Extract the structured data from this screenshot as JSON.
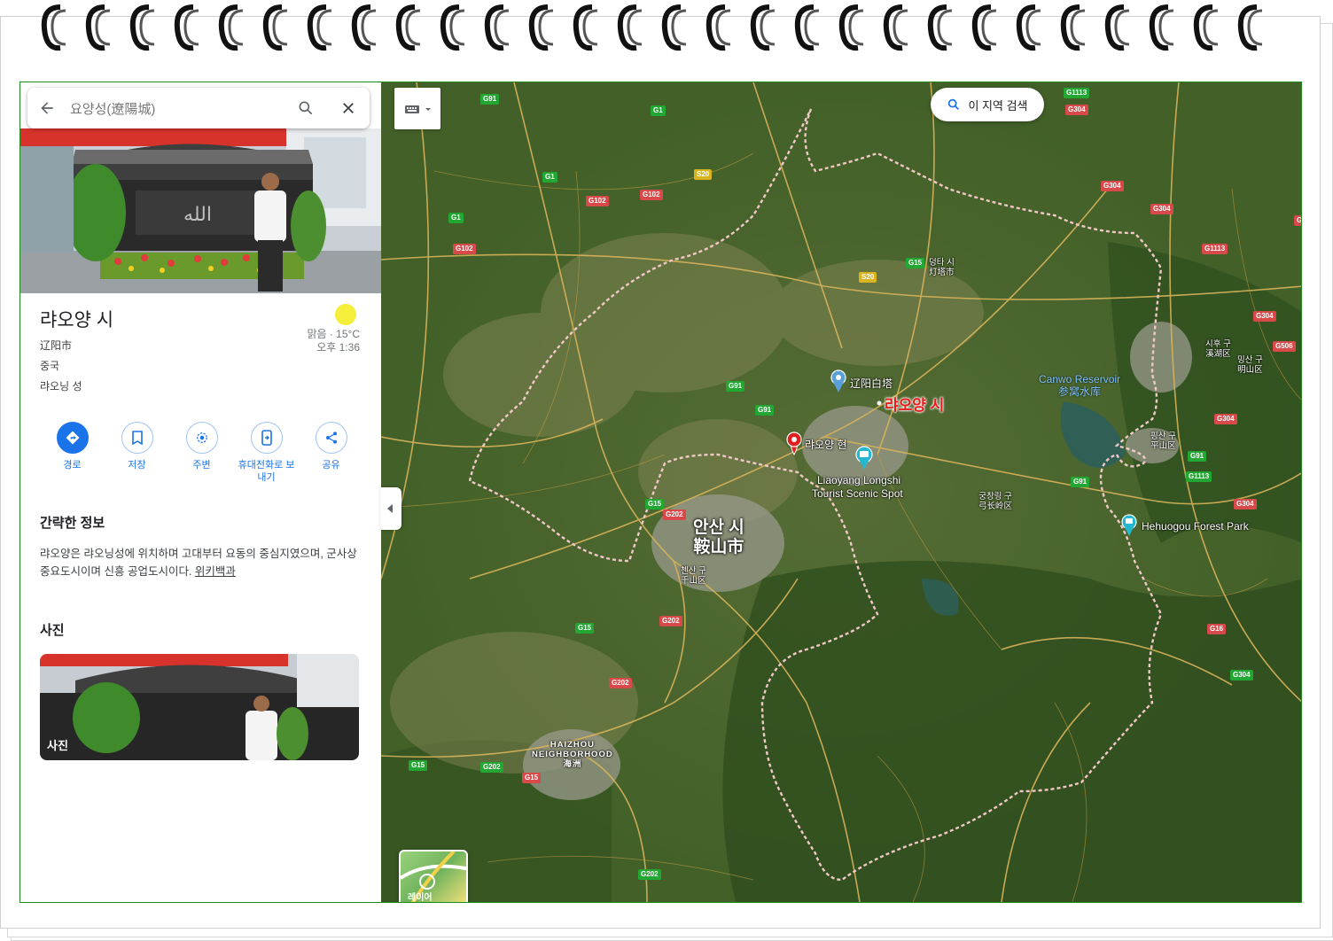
{
  "search": {
    "query": "요양성(遼陽城)"
  },
  "place": {
    "title": "랴오양 시",
    "native_name": "辽阳市",
    "country": "중국",
    "province": "랴오닝 성"
  },
  "weather": {
    "condition_temp": "맑음 · 15°C",
    "time": "오후 1:36"
  },
  "actions": [
    {
      "label": "경로",
      "icon": "directions-icon"
    },
    {
      "label": "저장",
      "icon": "bookmark-icon"
    },
    {
      "label": "주변",
      "icon": "nearby-icon"
    },
    {
      "label": "휴대전화로 보내기",
      "icon": "send-to-phone-icon"
    },
    {
      "label": "공유",
      "icon": "share-icon"
    }
  ],
  "about": {
    "title": "간략한 정보",
    "text": "랴오양은 랴오닝성에 위치하며 고대부터 요동의 중심지였으며, 군사상 중요도시이며 신흥 공업도시이다.",
    "link": "위키백과"
  },
  "photos": {
    "title": "사진",
    "caption": "사진"
  },
  "hero_calligraphy": "الله",
  "map": {
    "area_search": "이 지역 검색",
    "layer_label": "레이어",
    "labels": {
      "liaoyang_city": "랴오양 시",
      "baita": "辽阳白塔",
      "liaoyang_county": "랴오양 현",
      "longshi_1": "Liaoyang Longshi",
      "longshi_2": "Tourist Scenic Spot",
      "anshan_ko": "안산 시",
      "anshan_zh": "鞍山市",
      "qianshan_ko": "첸산 구",
      "qianshan_zh": "千山区",
      "dengta_ko": "덩타 시",
      "dengta_zh": "灯塔市",
      "canwo_en": "Canwo Reservoir",
      "canwo_zh": "参窝水库",
      "hehuogou": "Hehuogou Forest Park",
      "gongchangling_ko": "궁창링 구",
      "gongchangling_zh": "弓长岭区",
      "pingshan_ko": "핑산 구",
      "pingshan_zh": "平山区",
      "xihu_ko": "시후 구",
      "xihu_zh": "溪湖区",
      "mingshan_ko": "밍산 구",
      "mingshan_zh": "明山区",
      "haizhou_1": "HAIZHOU",
      "haizhou_2": "NEIGHBORHOOD",
      "haizhou_zh": "海洲"
    },
    "shields": [
      "G91",
      "G1",
      "S20",
      "G1",
      "G102",
      "G102",
      "G1",
      "G102",
      "G1113",
      "G304",
      "G304",
      "G304",
      "G1113",
      "G304",
      "G506",
      "G304",
      "G15",
      "S20",
      "G91",
      "G91",
      "G15",
      "G202",
      "G91",
      "G1113",
      "G91",
      "G304",
      "G15",
      "G202",
      "G202",
      "G15",
      "G202",
      "G15",
      "G202",
      "G16",
      "G304",
      "G1113"
    ]
  },
  "colors": {
    "accent": "#1a73e8",
    "title_red": "#e81b1b",
    "frame_green": "#1f8a1f"
  }
}
